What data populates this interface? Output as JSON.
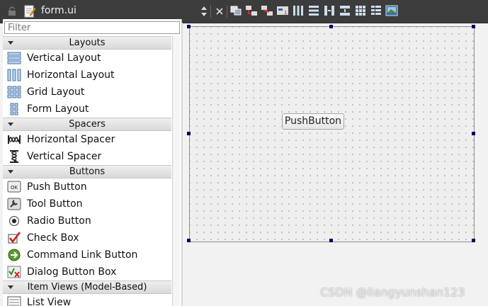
{
  "window": {
    "file_title": "form.ui"
  },
  "widget_box": {
    "filter_placeholder": "Filter",
    "categories": [
      {
        "label": "Layouts",
        "items": [
          {
            "label": "Vertical Layout",
            "icon": "vertical-layout-icon"
          },
          {
            "label": "Horizontal Layout",
            "icon": "horizontal-layout-icon"
          },
          {
            "label": "Grid Layout",
            "icon": "grid-layout-icon"
          },
          {
            "label": "Form Layout",
            "icon": "form-layout-icon"
          }
        ]
      },
      {
        "label": "Spacers",
        "items": [
          {
            "label": "Horizontal Spacer",
            "icon": "horizontal-spacer-icon"
          },
          {
            "label": "Vertical Spacer",
            "icon": "vertical-spacer-icon"
          }
        ]
      },
      {
        "label": "Buttons",
        "items": [
          {
            "label": "Push Button",
            "icon": "push-button-icon"
          },
          {
            "label": "Tool Button",
            "icon": "tool-button-icon"
          },
          {
            "label": "Radio Button",
            "icon": "radio-button-icon"
          },
          {
            "label": "Check Box",
            "icon": "check-box-icon"
          },
          {
            "label": "Command Link Button",
            "icon": "command-link-icon"
          },
          {
            "label": "Dialog Button Box",
            "icon": "dialog-button-box-icon"
          }
        ]
      },
      {
        "label": "Item Views (Model-Based)",
        "items": [
          {
            "label": "List View",
            "icon": "list-view-icon"
          }
        ]
      }
    ]
  },
  "form": {
    "push_button_label": "PushButton"
  },
  "watermark": "CSDN @liangyunshan123",
  "colors": {
    "topbar": "#3c3c3c",
    "handle": "#000066",
    "form_bg": "#efefef"
  }
}
